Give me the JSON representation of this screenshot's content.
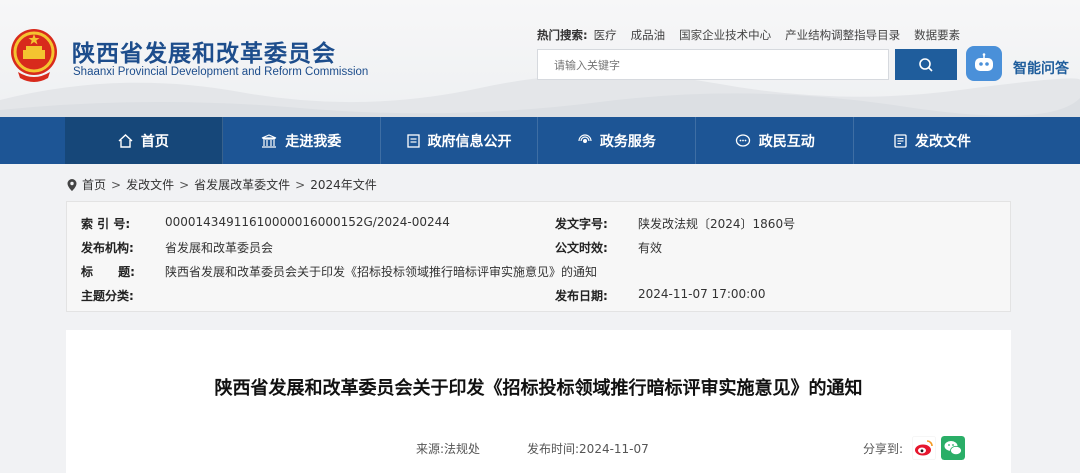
{
  "header": {
    "title_cn": "陕西省发展和改革委员会",
    "title_en": "Shaanxi Provincial Development and Reform Commission",
    "hot_label": "热门搜索:",
    "hot_items": [
      "医疗",
      "成品油",
      "国家企业技术中心",
      "产业结构调整指导目录",
      "数据要素"
    ],
    "search_placeholder": "请输入关键字",
    "ai_label": "智能问答"
  },
  "nav": {
    "items": [
      {
        "label": "首页",
        "icon": "home-icon"
      },
      {
        "label": "走进我委",
        "icon": "building-icon"
      },
      {
        "label": "政府信息公开",
        "icon": "document-icon"
      },
      {
        "label": "政务服务",
        "icon": "service-icon"
      },
      {
        "label": "政民互动",
        "icon": "chat-icon"
      },
      {
        "label": "发改文件",
        "icon": "file-icon"
      }
    ]
  },
  "breadcrumb": [
    "首页",
    "发改文件",
    "省发展改革委文件",
    "2024年文件"
  ],
  "info": {
    "index_label": "索 引 号:",
    "index_value": "00001434911610000016000152G/2024-00244",
    "doc_no_label": "发文字号:",
    "doc_no_value": "陕发改法规〔2024〕1860号",
    "org_label": "发布机构:",
    "org_value": "省发展和改革委员会",
    "validity_label": "公文时效:",
    "validity_value": "有效",
    "title_label": "标      题:",
    "title_value": "陕西省发展和改革委员会关于印发《招标投标领域推行暗标评审实施意见》的通知",
    "topic_label": "主题分类:",
    "topic_value": "",
    "date_label": "发布日期:",
    "date_value": "2024-11-07 17:00:00"
  },
  "article": {
    "title": "陕西省发展和改革委员会关于印发《招标投标领域推行暗标评审实施意见》的通知",
    "source": "来源:法规处",
    "pub_time": "发布时间:2024-11-07",
    "share_label": "分享到:"
  },
  "colors": {
    "brand_blue": "#1d5595",
    "title_blue": "#1d4d8c",
    "weibo": "#e6162d",
    "wechat": "#2aae67"
  }
}
